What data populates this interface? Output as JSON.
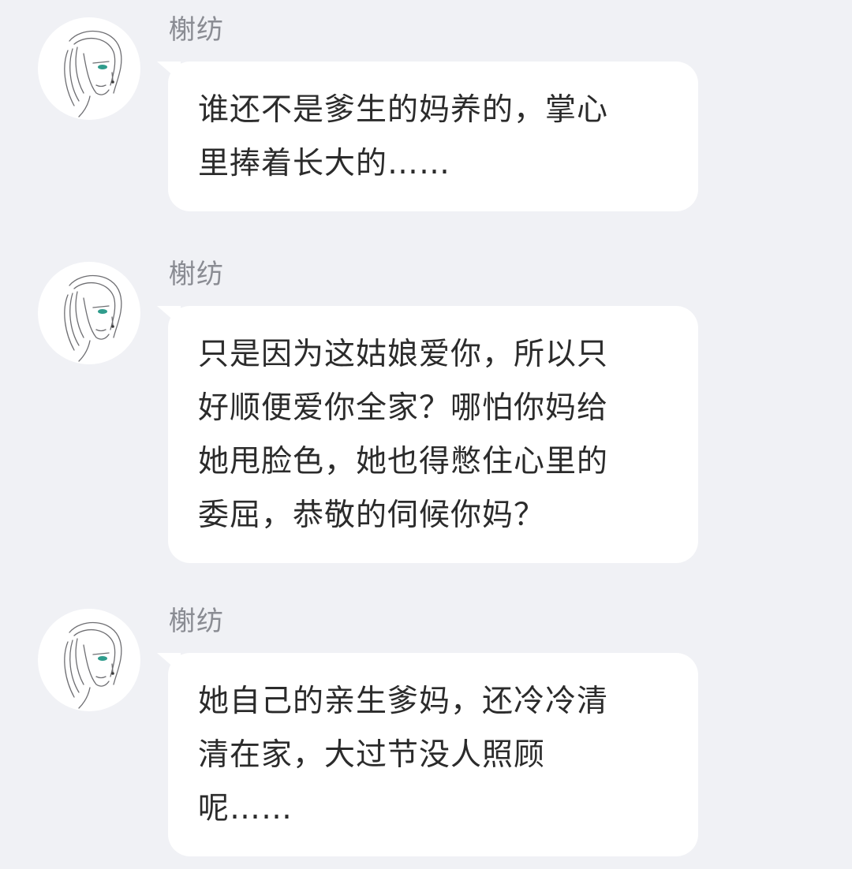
{
  "messages": [
    {
      "sender": "榭纺",
      "text": "谁还不是爹生的妈养的，掌心\n里捧着长大的……"
    },
    {
      "sender": "榭纺",
      "text": "只是因为这姑娘爱你，所以只\n好顺便爱你全家？哪怕你妈给\n她甩脸色，她也得憋住心里的\n委屈，恭敬的伺候你妈？"
    },
    {
      "sender": "榭纺",
      "text": "她自己的亲生爹妈，还冷冷清\n清在家，大过节没人照顾\n呢……"
    }
  ],
  "colors": {
    "background": "#f0f1f5",
    "bubble": "#ffffff",
    "sender_name": "#8a8c93",
    "message_text": "#2b2b2b"
  },
  "icons": {
    "avatar": "line-art-woman-face-icon"
  }
}
